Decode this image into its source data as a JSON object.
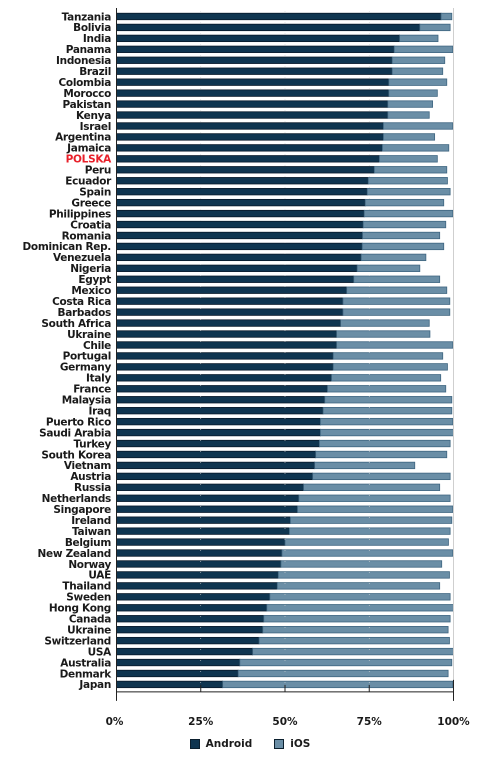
{
  "chart_data": {
    "type": "bar",
    "orientation": "horizontal",
    "stacked": true,
    "title": "",
    "xlabel": "",
    "ylabel": "",
    "xlim": [
      0,
      100
    ],
    "x_ticks": [
      "0%",
      "25%",
      "50%",
      "75%",
      "100%"
    ],
    "x_tick_values": [
      0,
      25,
      50,
      75,
      100
    ],
    "grid": false,
    "legend_position": "bottom-center",
    "highlight_category": "POLSKA",
    "highlight_color": "#e8202a",
    "categories": [
      "Tanzania",
      "Bolivia",
      "India",
      "Panama",
      "Indonesia",
      "Brazil",
      "Colombia",
      "Morocco",
      "Pakistan",
      "Kenya",
      "Israel",
      "Argentina",
      "Jamaica",
      "POLSKA",
      "Peru",
      "Ecuador",
      "Spain",
      "Greece",
      "Philippines",
      "Croatia",
      "Romania",
      "Dominican Rep.",
      "Venezuela",
      "Nigeria",
      "Egypt",
      "Mexico",
      "Costa Rica",
      "Barbados",
      "South Africa",
      "Ukraine",
      "Chile",
      "Portugal",
      "Germany",
      "Italy",
      "France",
      "Malaysia",
      "Iraq",
      "Puerto Rico",
      "Saudi Arabia",
      "Turkey",
      "South Korea",
      "Vietnam",
      "Austria",
      "Russia",
      "Netherlands",
      "Singapore",
      "Ireland",
      "Taiwan",
      "Belgium",
      "New Zealand",
      "Norway",
      "UAE",
      "Thailand",
      "Sweden",
      "Hong Kong",
      "Canada",
      "Ukraine",
      "Switzerland",
      "USA",
      "Australia",
      "Denmark",
      "Japan"
    ],
    "series": [
      {
        "name": "Android",
        "color": "#0f3550",
        "values": [
          96.3,
          90.0,
          84.0,
          82.4,
          81.8,
          81.8,
          80.8,
          80.8,
          80.5,
          80.5,
          79.2,
          79.2,
          78.9,
          78.0,
          76.5,
          74.7,
          74.4,
          73.8,
          73.5,
          73.2,
          73.0,
          72.9,
          72.6,
          71.4,
          70.4,
          68.3,
          67.2,
          67.2,
          66.5,
          65.3,
          65.3,
          64.3,
          64.3,
          63.8,
          62.6,
          61.8,
          61.3,
          60.5,
          60.5,
          60.2,
          59.1,
          58.8,
          58.2,
          55.5,
          54.1,
          53.7,
          51.6,
          51.3,
          50.0,
          49.1,
          48.8,
          48.0,
          47.7,
          45.5,
          44.6,
          43.7,
          43.4,
          42.3,
          40.4,
          36.6,
          36.1,
          31.5
        ]
      },
      {
        "name": "iOS",
        "color": "#6a8ea6",
        "values": [
          3.2,
          9.0,
          11.4,
          17.4,
          15.6,
          15.0,
          17.2,
          14.4,
          13.3,
          12.3,
          20.6,
          15.2,
          19.7,
          17.2,
          21.5,
          23.5,
          24.6,
          23.3,
          26.3,
          24.5,
          22.9,
          24.2,
          19.2,
          18.6,
          25.5,
          29.7,
          31.7,
          31.7,
          26.3,
          27.7,
          34.5,
          32.5,
          33.9,
          32.4,
          35.1,
          37.7,
          38.2,
          39.3,
          39.5,
          38.8,
          38.9,
          29.7,
          40.8,
          40.4,
          44.9,
          46.1,
          47.9,
          47.7,
          48.5,
          50.7,
          47.7,
          50.8,
          48.2,
          53.5,
          55.4,
          55.3,
          55.0,
          56.5,
          59.6,
          62.9,
          62.3,
          68.3
        ]
      }
    ]
  },
  "legend": {
    "items": [
      {
        "label": "Android",
        "color": "#0f3550"
      },
      {
        "label": "iOS",
        "color": "#6a8ea6"
      }
    ]
  }
}
